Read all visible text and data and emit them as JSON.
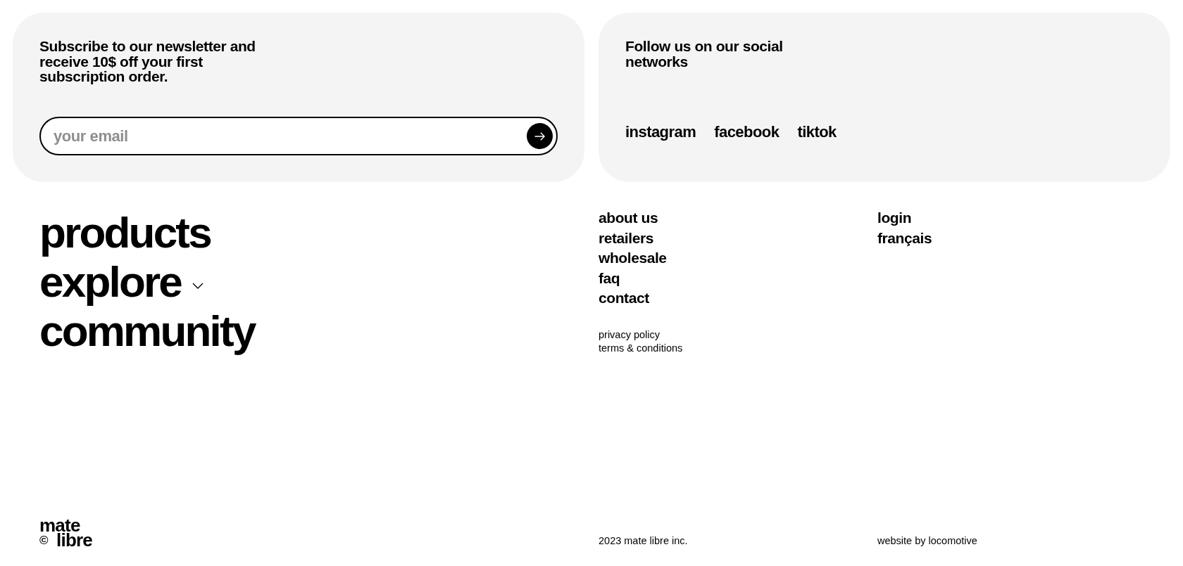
{
  "newsletter": {
    "title": "Subscribe to our newsletter and receive 10$ off your first subscription order.",
    "email_field": {
      "placeholder": "your email"
    }
  },
  "social": {
    "title": "Follow us on our social networks",
    "links": [
      "instagram",
      "facebook",
      "tiktok"
    ]
  },
  "main_nav": [
    {
      "label": "products",
      "kind": "link"
    },
    {
      "label": "explore",
      "kind": "dropdown"
    },
    {
      "label": "community",
      "kind": "link"
    }
  ],
  "secondary_nav": [
    "about us",
    "retailers",
    "wholesale",
    "faq",
    "contact"
  ],
  "legal_links": [
    "privacy policy",
    "terms & conditions"
  ],
  "utility_links": [
    "login",
    "français"
  ],
  "footer": {
    "logo": {
      "top": "mate",
      "mark": "©",
      "bottom": "libre"
    },
    "copyright": "2023 mate libre inc.",
    "credit": "website by locomotive"
  }
}
